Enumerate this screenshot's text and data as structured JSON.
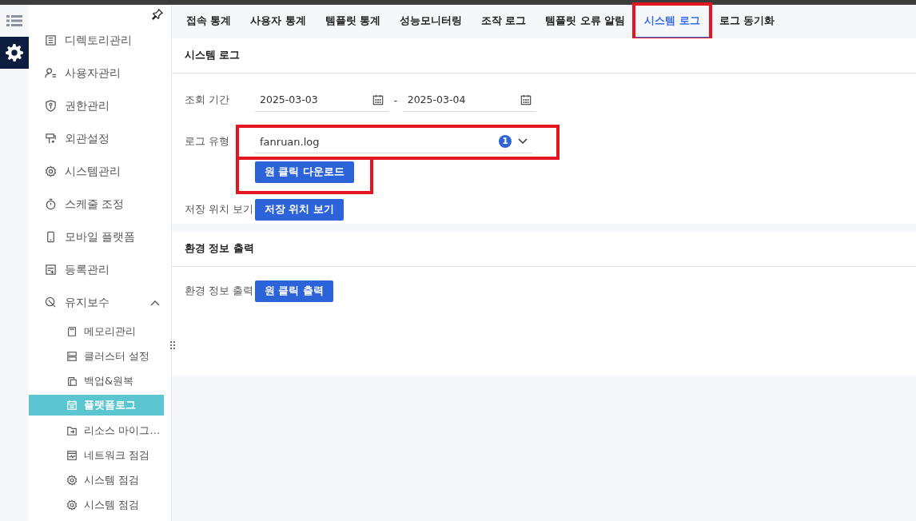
{
  "rail": [
    {
      "kind": "list",
      "selected": false
    },
    {
      "kind": "settings",
      "selected": true
    }
  ],
  "sidebar": {
    "items": [
      {
        "label": "디렉토리관리",
        "selected": false
      },
      {
        "label": "사용자관리",
        "selected": false
      },
      {
        "label": "권한관리",
        "selected": false
      },
      {
        "label": "외관설정",
        "selected": false
      },
      {
        "label": "시스템관리",
        "selected": false
      },
      {
        "label": "스케줄 조정",
        "selected": false
      },
      {
        "label": "모바일 플랫폼",
        "selected": false
      },
      {
        "label": "등록관리",
        "selected": false
      },
      {
        "label": "유지보수",
        "expanded": true,
        "selected": false,
        "children": [
          {
            "label": "메모리관리",
            "selected": false
          },
          {
            "label": "클러스터 설정",
            "selected": false
          },
          {
            "label": "백업&원복",
            "selected": false
          },
          {
            "label": "플랫폼로그",
            "selected": true
          },
          {
            "label": "리소스 마이그…",
            "selected": false
          },
          {
            "label": "네트워크 점검",
            "selected": false
          },
          {
            "label": "시스템 점검",
            "selected": false
          },
          {
            "label": "시스템 점검",
            "selected": false
          }
        ]
      }
    ]
  },
  "tabs": [
    {
      "label": "접속 통계",
      "selected": false,
      "highlighted": false
    },
    {
      "label": "사용자 통계",
      "selected": false,
      "highlighted": false
    },
    {
      "label": "템플릿 통계",
      "selected": false,
      "highlighted": false
    },
    {
      "label": "성능모니터링",
      "selected": false,
      "highlighted": false
    },
    {
      "label": "조작 로그",
      "selected": false,
      "highlighted": false
    },
    {
      "label": "템플릿 오류 알림",
      "selected": false,
      "highlighted": false
    },
    {
      "label": "시스템 로그",
      "selected": true,
      "highlighted": true
    },
    {
      "label": "로그 동기화",
      "selected": false,
      "highlighted": false
    }
  ],
  "system_log": {
    "title": "시스템 로그",
    "period": {
      "label": "조회 기간",
      "start": "2025-03-03",
      "separator": "-",
      "end": "2025-03-04"
    },
    "log_type": {
      "label": "로그 유형",
      "value": "fanruan.log",
      "count": "1",
      "highlighted": true
    },
    "download_button": {
      "label": "원 클릭 다운로드",
      "highlighted": true
    },
    "location": {
      "label": "저장 위치 보기",
      "button": "저장 위치 보기"
    }
  },
  "environment": {
    "title": "환경 정보 출력",
    "label": "환경 정보 출력",
    "button": "원 클릭 출력"
  }
}
